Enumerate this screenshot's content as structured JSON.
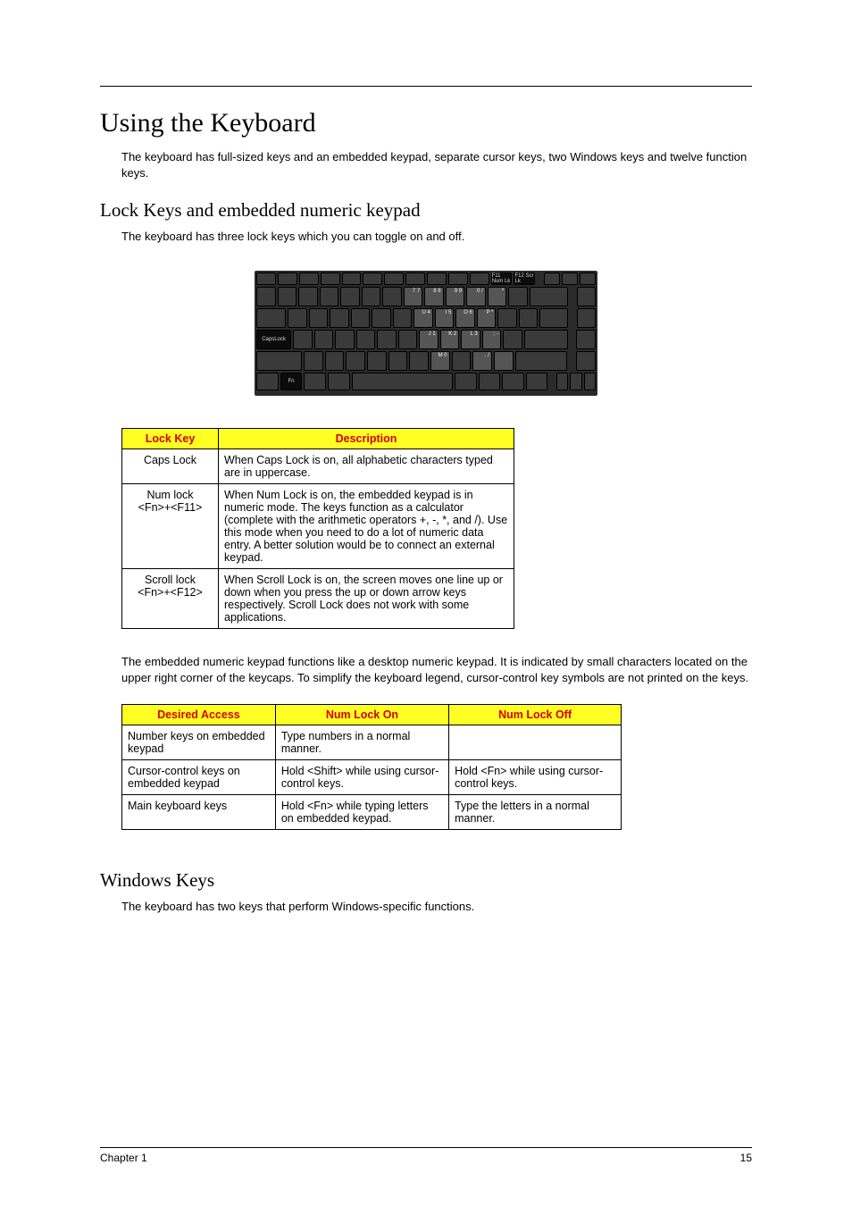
{
  "title": "Using the Keyboard",
  "intro": "The keyboard has full-sized keys and an embedded keypad, separate cursor keys, two Windows keys and twelve function keys.",
  "section_lock": {
    "heading": "Lock Keys and embedded numeric keypad",
    "intro": "The keyboard has three lock keys which you can toggle on and off."
  },
  "kbd": {
    "caps_label": "CapsLock",
    "fn_label": "Fn",
    "f11": "F11 Num Lk",
    "f12": "F12 Scr Lk",
    "u": "U 4",
    "i": "I 5",
    "o": "O 6",
    "p": "P *",
    "j": "J 1",
    "k": "K 2",
    "l": "L 3",
    "semi": "; -",
    "m": "M 0",
    "dot": ". /",
    "seven": "7 7",
    "eight": "8 8",
    "nine": "9 9",
    "zero": "0 /",
    "star": "*"
  },
  "lock_table": {
    "headers": [
      "Lock Key",
      "Description"
    ],
    "rows": [
      {
        "key": "Caps Lock",
        "desc": "When Caps Lock is on, all alphabetic characters typed are in uppercase."
      },
      {
        "key": "Num lock\n<Fn>+<F11>",
        "desc": "When Num Lock is on, the embedded keypad is in numeric mode. The keys function as a calculator (complete with the arithmetic operators +, -, *, and /). Use this mode when you need to do a lot of numeric data entry. A better solution would be to connect an external keypad."
      },
      {
        "key": "Scroll lock\n<Fn>+<F12>",
        "desc": "When Scroll Lock is on, the screen moves one line up or down when you press the up or down arrow keys respectively. Scroll Lock does not work with some applications."
      }
    ]
  },
  "embedded_desc": "The embedded numeric keypad functions like a desktop numeric keypad. It is indicated by small characters located on the upper right corner of the keycaps. To simplify the keyboard legend, cursor-control key symbols are not printed on the keys.",
  "access_table": {
    "headers": [
      "Desired Access",
      "Num Lock On",
      "Num Lock Off"
    ],
    "rows": [
      {
        "c1": "Number keys on embedded keypad",
        "c2": "Type numbers in a normal manner.",
        "c3": ""
      },
      {
        "c1": "Cursor-control keys on embedded keypad",
        "c2": "Hold <Shift> while using cursor-control keys.",
        "c3": "Hold <Fn> while using cursor-control keys."
      },
      {
        "c1": "Main keyboard keys",
        "c2": "Hold <Fn> while typing letters on embedded keypad.",
        "c3": "Type the letters in a normal manner."
      }
    ]
  },
  "section_windows": {
    "heading": "Windows Keys",
    "intro": "The keyboard has two keys that perform Windows-specific functions."
  },
  "footer": {
    "left": "Chapter 1",
    "right": "15"
  }
}
